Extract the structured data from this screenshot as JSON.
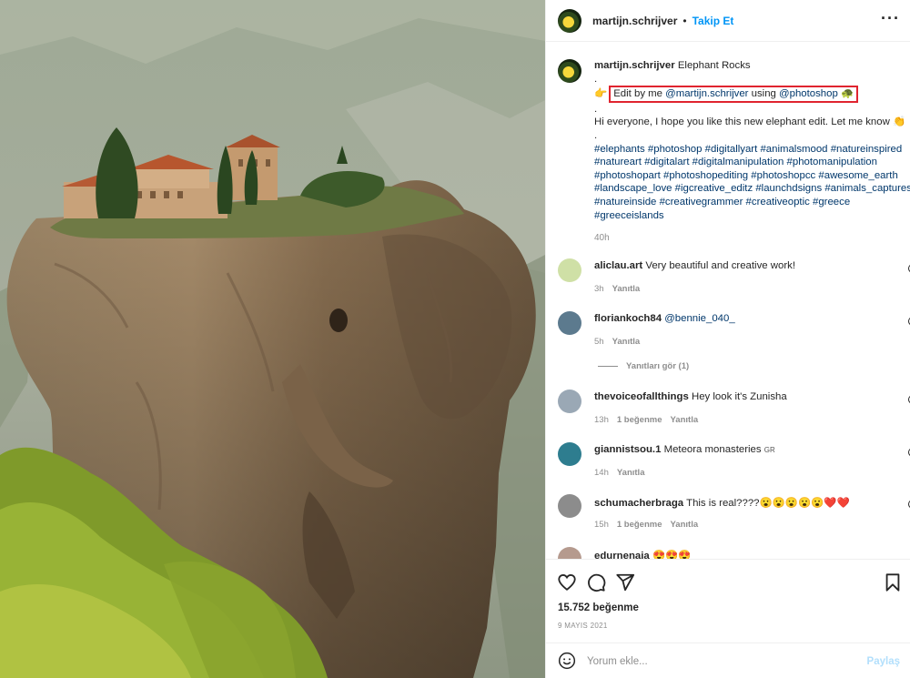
{
  "post": {
    "image_alt": "Elephant shaped rock with monastery on top",
    "author": "martijn.schrijver",
    "follow_label": "Takip Et",
    "separator": "•"
  },
  "caption": {
    "username": "martijn.schrijver",
    "title": "Elephant Rocks",
    "dot1": ".",
    "edit_prefix": "Edit by me ",
    "edit_mention": "@martijn.schrijver",
    "edit_using": " using ",
    "edit_tool": "@photoshop",
    "edit_emoji": "🐢",
    "point_emoji": "👉",
    "dot2": ".",
    "greeting": "Hi everyone, I hope you like this new elephant edit. Let me know 👏",
    "dot3": ".",
    "hashtags": [
      "#elephants",
      "#photoshop",
      "#digitallyart",
      "#animalsmood",
      "#natureinspired",
      "#natureart",
      "#digitalart",
      "#digitalmanipulation",
      "#photomanipulation",
      "#photoshopart",
      "#photoshopediting",
      "#photoshopcc",
      "#awesome_earth",
      "#landscape_love",
      "#igcreative_editz",
      "#launchdsigns",
      "#animals_captures",
      "#natureinside",
      "#creativegrammer",
      "#creativeoptic",
      "#greece",
      "#greeceislands"
    ],
    "time": "40h"
  },
  "comments": [
    {
      "user": "aliclau.art",
      "text": "Very beautiful and creative work!",
      "time": "3h",
      "likes": "",
      "reply": "Yanıtla",
      "color": "#cfe0a6"
    },
    {
      "user": "floriankoch84",
      "text": "@bennie_040_",
      "time": "5h",
      "likes": "",
      "reply": "Yanıtla",
      "color": "#5c7a8e"
    },
    {
      "user": "thevoiceofallthings",
      "text": "Hey look it's Zunisha",
      "time": "13h",
      "likes": "1 beğenme",
      "reply": "Yanıtla",
      "color": "#9aa8b5"
    },
    {
      "user": "giannistsou.1",
      "text": "Meteora monasteries ",
      "flag": "GR",
      "time": "14h",
      "likes": "",
      "reply": "Yanıtla",
      "color": "#2e7d8f"
    },
    {
      "user": "schumacherbraga",
      "text": "This is real????😮😮😮😮😮❤️❤️",
      "time": "15h",
      "likes": "1 beğenme",
      "reply": "Yanıtla",
      "color": "#8c8c8c"
    },
    {
      "user": "edurnenaia",
      "text": "😍😍😍",
      "time": "",
      "likes": "",
      "reply": "",
      "color": "#b59a8e"
    }
  ],
  "view_replies": "Yanıtları gör (1)",
  "actions": {
    "like_count": "15.752 beğenme",
    "date": "9 MAYIS 2021"
  },
  "comment_box": {
    "placeholder": "Yorum ekle...",
    "post_label": "Paylaş"
  },
  "icons": {
    "more": "more-icon",
    "like": "heart-icon",
    "comment": "comment-icon",
    "share": "share-icon",
    "save": "bookmark-icon",
    "emoji": "smiley-icon"
  },
  "colors": {
    "link": "#00376b",
    "follow": "#0095f6",
    "highlight": "#e0242f",
    "muted": "#8e8e8e"
  }
}
